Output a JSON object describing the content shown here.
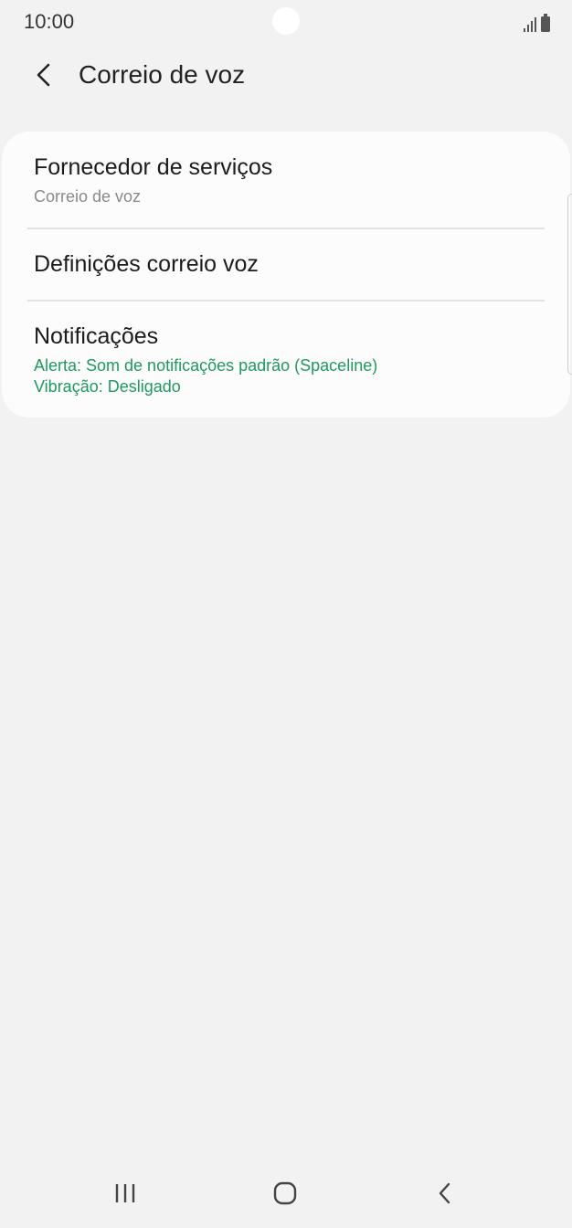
{
  "status_bar": {
    "time": "10:00",
    "signal_icon": "signal-icon",
    "battery_icon": "battery-icon"
  },
  "header": {
    "back_icon": "back-arrow-icon",
    "title": "Correio de voz"
  },
  "settings": {
    "items": [
      {
        "title": "Fornecedor de serviços",
        "subtitle": "Correio de voz"
      },
      {
        "title": "Definições correio voz"
      },
      {
        "title": "Notificações",
        "subtitle_lines": [
          "Alerta: Som de notificações padrão (Spaceline)",
          "Vibração: Desligado"
        ]
      }
    ]
  },
  "nav_bar": {
    "recents_icon": "recent-apps-icon",
    "home_icon": "home-icon",
    "back_icon": "back-icon"
  },
  "colors": {
    "background": "#f2f2f2",
    "card": "#fcfcfc",
    "accent_green": "#1e9a5e",
    "secondary_text": "#8a8a8a"
  }
}
